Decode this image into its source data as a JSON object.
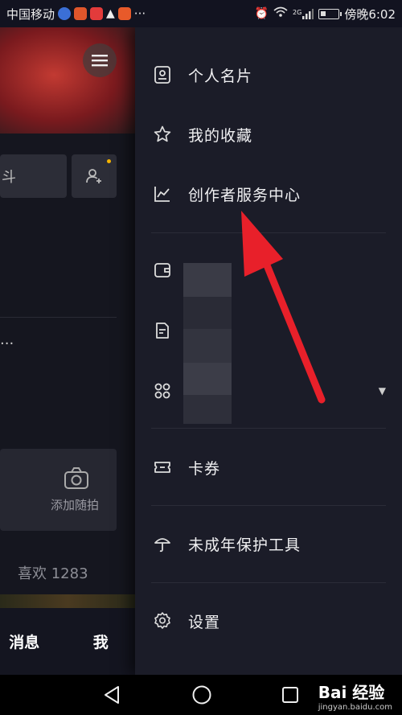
{
  "status_bar": {
    "carrier": "中国移动",
    "time": "傍晚6:02",
    "dots": "···",
    "network": "2G"
  },
  "background_page": {
    "edit_button_fragment": "斗",
    "more_text": "...",
    "add_photo_label": "添加随拍",
    "likes_text": "喜欢 1283",
    "nav_messages": "消息",
    "nav_me": "我"
  },
  "drawer": {
    "items": [
      {
        "label": "个人名片",
        "icon": "id-card-icon"
      },
      {
        "label": "我的收藏",
        "icon": "star-icon"
      },
      {
        "label": "创作者服务中心",
        "icon": "chart-icon"
      },
      {
        "label": "",
        "icon": "wallet-icon"
      },
      {
        "label": "",
        "icon": "document-icon"
      },
      {
        "label": "",
        "icon": "apps-icon"
      },
      {
        "label": "卡券",
        "icon": "ticket-icon"
      },
      {
        "label": "未成年保护工具",
        "icon": "umbrella-icon"
      },
      {
        "label": "设置",
        "icon": "gear-icon"
      }
    ]
  },
  "watermark": {
    "brand": "Bai 经验",
    "url": "jingyan.baidu.com"
  },
  "colors": {
    "arrow": "#e8202a",
    "drawer_bg": "#1b1c28",
    "page_bg": "#15161f"
  }
}
